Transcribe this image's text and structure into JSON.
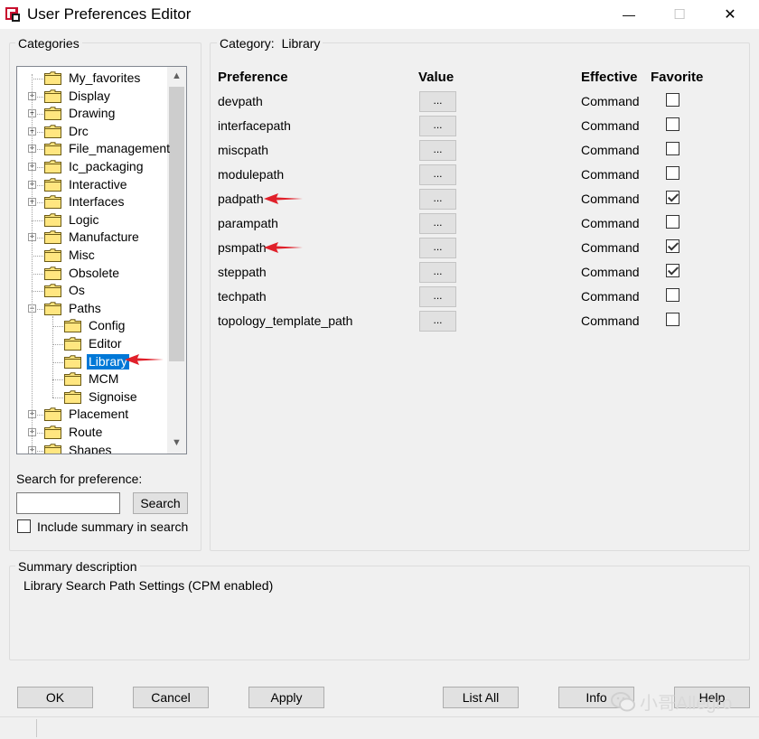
{
  "window": {
    "title": "User Preferences Editor",
    "minimize_glyph": "—",
    "maximize_glyph": "☐",
    "close_glyph": "✕"
  },
  "categories": {
    "label": "Categories",
    "tree": [
      {
        "label": "My_favorites",
        "expandable": false,
        "level": 0
      },
      {
        "label": "Display",
        "expandable": true,
        "level": 0
      },
      {
        "label": "Drawing",
        "expandable": true,
        "level": 0
      },
      {
        "label": "Drc",
        "expandable": true,
        "level": 0
      },
      {
        "label": "File_management",
        "expandable": true,
        "level": 0
      },
      {
        "label": "Ic_packaging",
        "expandable": true,
        "level": 0
      },
      {
        "label": "Interactive",
        "expandable": true,
        "level": 0
      },
      {
        "label": "Interfaces",
        "expandable": true,
        "level": 0
      },
      {
        "label": "Logic",
        "expandable": false,
        "level": 0
      },
      {
        "label": "Manufacture",
        "expandable": true,
        "level": 0
      },
      {
        "label": "Misc",
        "expandable": false,
        "level": 0
      },
      {
        "label": "Obsolete",
        "expandable": false,
        "level": 0
      },
      {
        "label": "Os",
        "expandable": false,
        "level": 0
      },
      {
        "label": "Paths",
        "expandable": true,
        "expanded": true,
        "level": 0
      },
      {
        "label": "Config",
        "expandable": false,
        "level": 1
      },
      {
        "label": "Editor",
        "expandable": false,
        "level": 1
      },
      {
        "label": "Library",
        "expandable": false,
        "level": 1,
        "selected": true
      },
      {
        "label": "MCM",
        "expandable": false,
        "level": 1
      },
      {
        "label": "Signoise",
        "expandable": false,
        "level": 1
      },
      {
        "label": "Placement",
        "expandable": true,
        "level": 0
      },
      {
        "label": "Route",
        "expandable": true,
        "level": 0
      },
      {
        "label": "Shapes",
        "expandable": true,
        "level": 0
      }
    ]
  },
  "search": {
    "label": "Search for preference:",
    "value": "",
    "button": "Search",
    "include_summary_label": "Include summary in search",
    "include_summary_checked": false
  },
  "category_panel": {
    "label_prefix": "Category:",
    "category_name": "Library",
    "headers": {
      "preference": "Preference",
      "value": "Value",
      "effective": "Effective",
      "favorite": "Favorite"
    },
    "rows": [
      {
        "name": "devpath",
        "value_button": "...",
        "effective": "Command",
        "favorite": false,
        "marked": false
      },
      {
        "name": "interfacepath",
        "value_button": "...",
        "effective": "Command",
        "favorite": false,
        "marked": false
      },
      {
        "name": "miscpath",
        "value_button": "...",
        "effective": "Command",
        "favorite": false,
        "marked": false
      },
      {
        "name": "modulepath",
        "value_button": "...",
        "effective": "Command",
        "favorite": false,
        "marked": false
      },
      {
        "name": "padpath",
        "value_button": "...",
        "effective": "Command",
        "favorite": true,
        "marked": true
      },
      {
        "name": "parampath",
        "value_button": "...",
        "effective": "Command",
        "favorite": false,
        "marked": false
      },
      {
        "name": "psmpath",
        "value_button": "...",
        "effective": "Command",
        "favorite": true,
        "marked": true
      },
      {
        "name": "steppath",
        "value_button": "...",
        "effective": "Command",
        "favorite": true,
        "marked": false
      },
      {
        "name": "techpath",
        "value_button": "...",
        "effective": "Command",
        "favorite": false,
        "marked": false
      },
      {
        "name": "topology_template_path",
        "value_button": "...",
        "effective": "Command",
        "favorite": false,
        "marked": false
      }
    ]
  },
  "summary": {
    "label": "Summary description",
    "text": "Library Search Path Settings (CPM enabled)"
  },
  "buttons": {
    "ok": "OK",
    "cancel": "Cancel",
    "apply": "Apply",
    "list_all": "List All",
    "info": "Info",
    "help": "Help"
  },
  "watermark": {
    "text": "小哥Allegro"
  },
  "colors": {
    "selection": "#0078d7",
    "annotation_arrow": "#e0202a",
    "folder_fill": "#ffe680"
  }
}
